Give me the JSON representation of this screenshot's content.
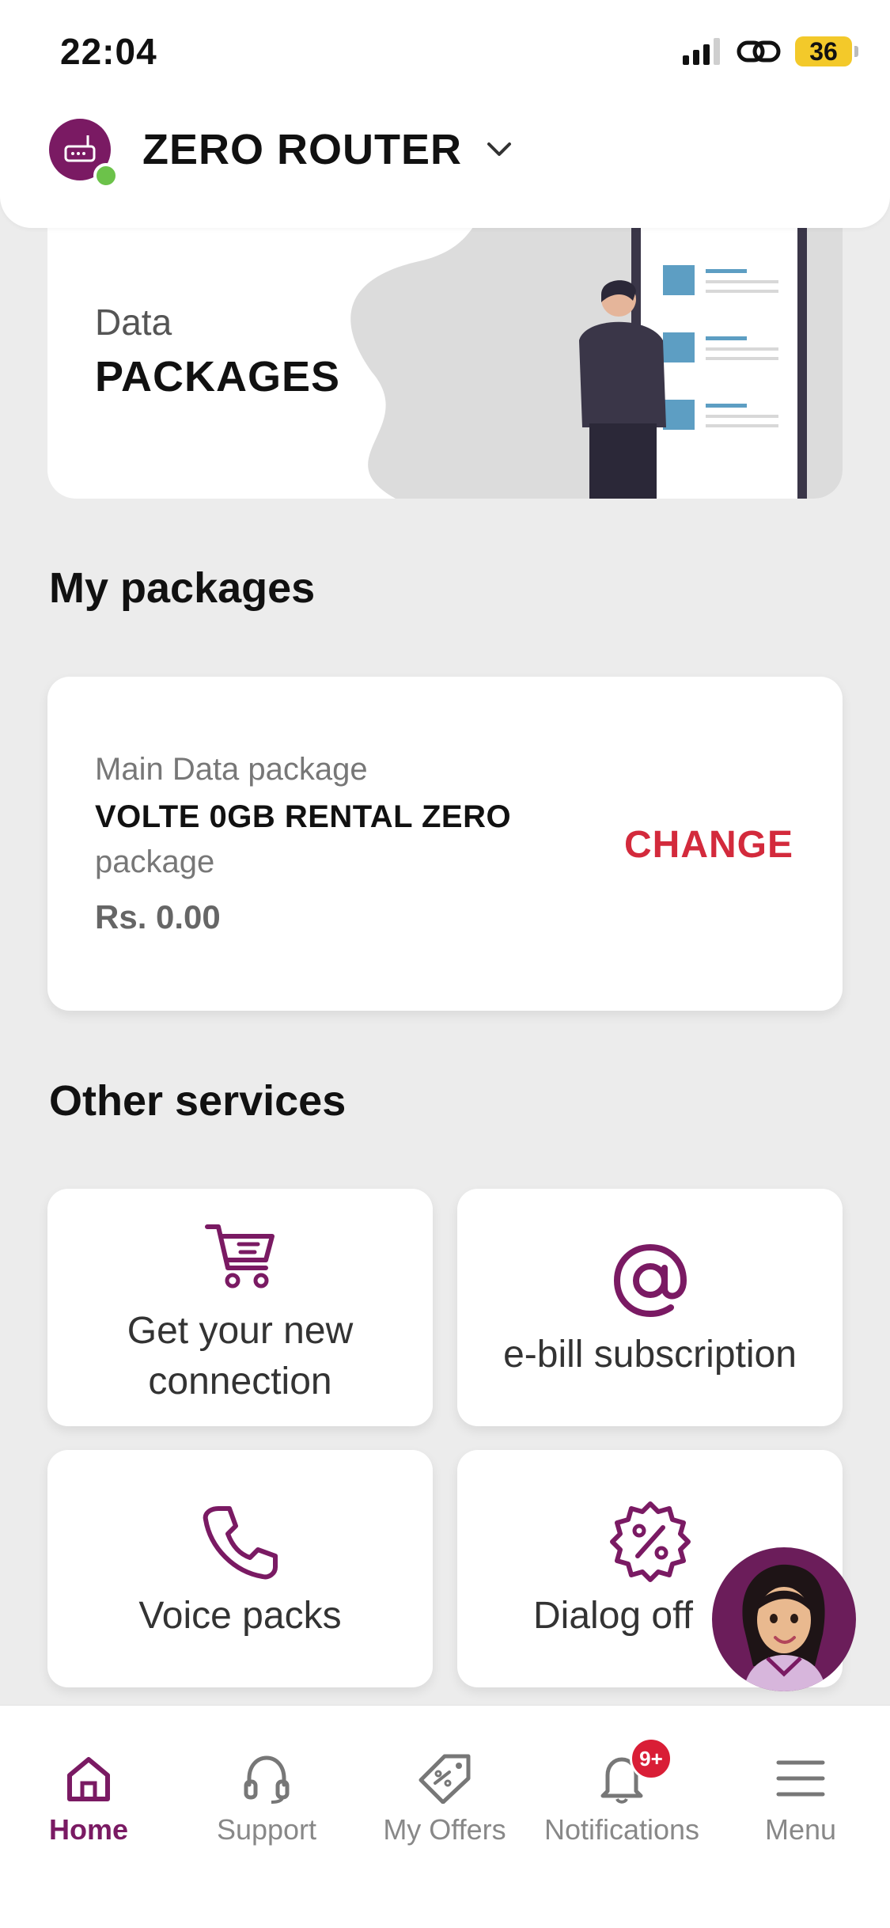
{
  "status_bar": {
    "time": "22:04",
    "battery": "36",
    "icons": [
      "signal-icon",
      "link-icon",
      "battery-icon"
    ]
  },
  "header": {
    "device_name": "ZERO ROUTER",
    "online": true
  },
  "banner": {
    "subtitle": "Data",
    "title": "PACKAGES"
  },
  "my_packages": {
    "title": "My packages",
    "card": {
      "label": "Main Data package",
      "name": "VOLTE 0GB RENTAL ZERO",
      "suffix": "package",
      "price": "Rs. 0.00",
      "change_label": "CHANGE"
    }
  },
  "other_services": {
    "title": "Other services",
    "tiles": [
      {
        "line1": "Get your new",
        "line2": "connection",
        "icon": "cart-icon"
      },
      {
        "line1": "e-bill subscription",
        "icon": "at-icon"
      },
      {
        "line1": "Voice packs",
        "icon": "phone-icon"
      },
      {
        "line1": "Dialog off",
        "icon": "percent-badge-icon"
      }
    ]
  },
  "bottom_nav": {
    "items": [
      {
        "label": "Home",
        "icon": "home-icon",
        "active": true
      },
      {
        "label": "Support",
        "icon": "headset-icon"
      },
      {
        "label": "My Offers",
        "icon": "tag-icon"
      },
      {
        "label": "Notifications",
        "icon": "bell-icon",
        "badge": "9+"
      },
      {
        "label": "Menu",
        "icon": "menu-icon"
      }
    ]
  },
  "colors": {
    "brand": "#7a1a63",
    "accent_red": "#d32a3c",
    "badge_red": "#d91e36",
    "online_green": "#6cc24a",
    "battery_yellow": "#f3c92a",
    "background": "#ececec"
  }
}
